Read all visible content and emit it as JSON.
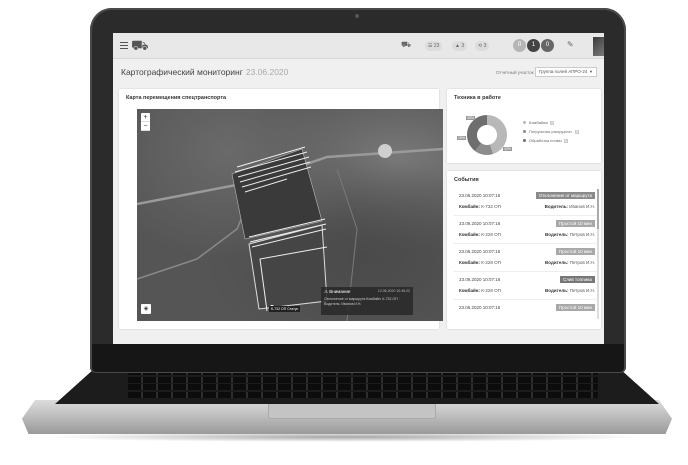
{
  "topbar": {
    "logo_glyph": "⛟",
    "btn_list": "☰ 23",
    "btn_alerts": "▲ 3",
    "btn_share": "⟲ 3",
    "badge_values": [
      "0",
      "1",
      "0"
    ],
    "badge_colors": [
      "#b5b5b5",
      "#444444",
      "#666666"
    ]
  },
  "page": {
    "title": "Картографический мониторинг",
    "date": "23.06.2020",
    "filter_label": "Отчетный участок",
    "filter_value": "Группа полей АПРО-24"
  },
  "map_card": {
    "title": "Карта перемещения спецтранспорта",
    "zoom_in": "+",
    "zoom_out": "−",
    "popup": {
      "head": "⚠ Внимание",
      "time": "12.06.2020 10:45:22",
      "text": "Отклонение от маршрута Комбайн: К-732 ОП · Водитель: Иванов И.Н."
    },
    "marker_label": "К-732 ОП Статус"
  },
  "fleet_card": {
    "title": "Техника в работе",
    "donut": {
      "values": [
        {
          "label": "45%",
          "color": "#b8b8b8"
        },
        {
          "label": "15%",
          "color": "#8c8c8c"
        },
        {
          "label": "40%",
          "color": "#6e6e6e"
        }
      ]
    },
    "legend": [
      {
        "label": "Комбайны",
        "count": "4",
        "color": "#b8b8b8"
      },
      {
        "label": "Погрузочно-разгрузочн.",
        "count": "5",
        "color": "#8c8c8c"
      },
      {
        "label": "Обработка почвы",
        "count": "4",
        "color": "#6e6e6e"
      }
    ]
  },
  "events_card": {
    "title": "События",
    "vehicle_label": "Комбайн:",
    "driver_label": "Водитель:",
    "items": [
      {
        "time": "23.06.2020 10:07:16",
        "status": "Отклонение от маршрута",
        "status_color": "#8a8a8a",
        "vehicle": "К-732 ОП",
        "driver": "Иванов И.Н."
      },
      {
        "time": "23.06.2020 10:07:16",
        "status": "Простой 10 мин",
        "status_color": "#a8a8a8",
        "vehicle": "К-228 ОП",
        "driver": "Петров И.Н."
      },
      {
        "time": "23.06.2020 10:07:16",
        "status": "Простой 10 мин",
        "status_color": "#a8a8a8",
        "vehicle": "К-228 ОП",
        "driver": "Петров И.Н."
      },
      {
        "time": "23.06.2020 10:07:16",
        "status": "Слив топлива",
        "status_color": "#777777",
        "vehicle": "К-228 ОП",
        "driver": "Петров И.Н."
      },
      {
        "time": "23.06.2020 10:07:16",
        "status": "Простой 10 мин",
        "status_color": "#a8a8a8",
        "vehicle": "",
        "driver": ""
      }
    ]
  }
}
